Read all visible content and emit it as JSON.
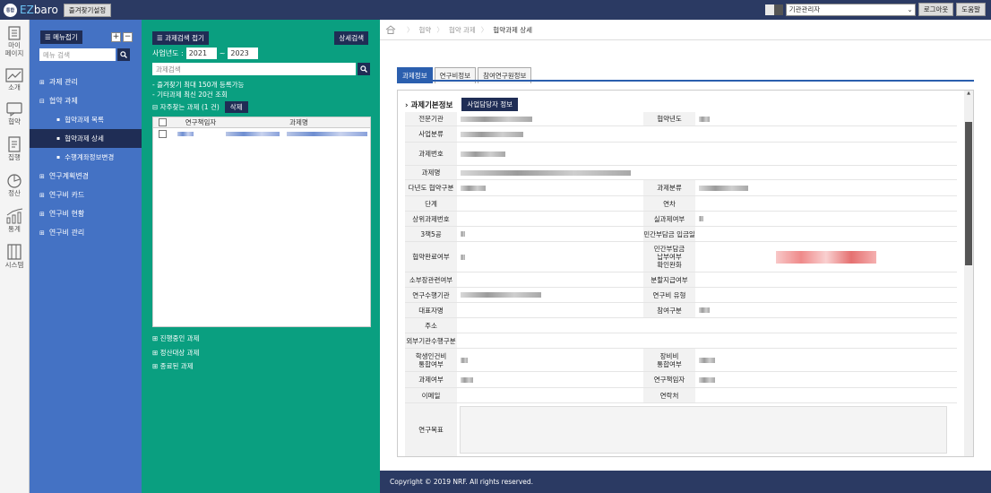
{
  "header": {
    "logo_badge": "통합",
    "logo_prefix": "EZ",
    "logo_suffix": "baro",
    "favorites_button": "즐겨찾기설정",
    "role_select": "기관관리자",
    "logout_button": "로그아웃",
    "help_button": "도움말"
  },
  "rail": [
    {
      "label": "마이\n페이지",
      "icon": "mypage-icon"
    },
    {
      "label": "소개",
      "icon": "chart-icon"
    },
    {
      "label": "협약",
      "icon": "chat-icon"
    },
    {
      "label": "집행",
      "icon": "document-icon"
    },
    {
      "label": "정산",
      "icon": "pie-icon"
    },
    {
      "label": "통계",
      "icon": "bar-chart-icon"
    },
    {
      "label": "시스템",
      "icon": "server-icon"
    }
  ],
  "menu": {
    "collapse_button": "메뉴접기",
    "expand_icon": "+",
    "collapse_icon": "−",
    "search_placeholder": "메뉴 검색",
    "items": [
      {
        "label": "과제 관리"
      },
      {
        "label": "협약 과제"
      },
      {
        "label": "연구계획변경"
      },
      {
        "label": "연구비 카드"
      },
      {
        "label": "연구비 현황"
      },
      {
        "label": "연구비 관리"
      }
    ],
    "subitems": [
      {
        "label": "협약과제 목록"
      },
      {
        "label": "협약과제 상세"
      },
      {
        "label": "수행계좌정보변경"
      }
    ]
  },
  "search_panel": {
    "collapse_button": "과제검색 접기",
    "detail_search_button": "상세검색",
    "year_label": "사업년도 :",
    "year_from": "2021",
    "year_to": "2023",
    "year_sep": "~",
    "search_placeholder": "과제검색",
    "note1": "- 즐겨찾기 최대 150개 등록가능",
    "note2": "- 기타과제 최신 20건 조회",
    "frequent_label": "자주찾는 과제",
    "frequent_count": "(1 건)",
    "delete_button": "삭제",
    "col_pi": "연구책임자",
    "col_title": "과제명",
    "footer_items": [
      "진행중인 과제",
      "정산대상 과제",
      "종료된 과제"
    ]
  },
  "breadcrumb": {
    "items": [
      "협약",
      "협약 과제"
    ],
    "current": "협약과제 상세"
  },
  "tabs": [
    "과제정보",
    "연구비정보",
    "참여연구원정보"
  ],
  "section": {
    "title": "과제기본정보",
    "button": "사업담당자 정보"
  },
  "fields": [
    {
      "left": "전문기관",
      "right": "협약년도"
    },
    {
      "left": "사업분류",
      "right": ""
    },
    {
      "left": "과제번호",
      "right": ""
    },
    {
      "left": "과제명",
      "right": ""
    },
    {
      "left": "다년도 협약구분",
      "right": "과제분류"
    },
    {
      "left": "단계",
      "right": "연차"
    },
    {
      "left": "상위과제번호",
      "right": "실과제여부"
    },
    {
      "left": "3책5공",
      "right": "민간부담금 입금일"
    },
    {
      "left": "협약완료여부",
      "right": "민간부담금\n납부여부\n확인완화"
    },
    {
      "left": "소부장관련여부",
      "right": "분할지급여부"
    },
    {
      "left": "연구수행기관",
      "right": "연구비 유형"
    },
    {
      "left": "대표자명",
      "right": "참여구분"
    },
    {
      "left": "주소",
      "right": ""
    },
    {
      "left": "외부기관수행구분",
      "right": ""
    },
    {
      "left": "학생인건비\n통합여부",
      "right": "장비비\n통합여부"
    },
    {
      "left": "과제여부",
      "right": "연구책임자"
    },
    {
      "left": "이메일",
      "right": "연락처"
    },
    {
      "left": "연구목표",
      "right": ""
    }
  ],
  "footer": "Copyright © 2019 NRF. All rights reserved."
}
